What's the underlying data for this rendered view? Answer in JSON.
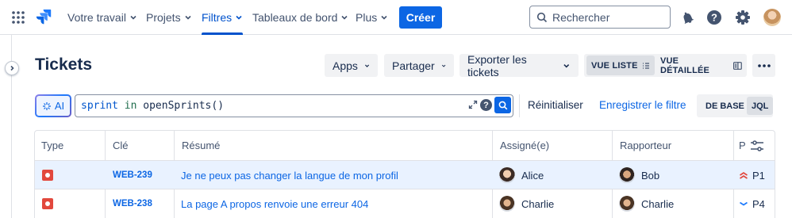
{
  "nav": {
    "items": [
      {
        "label": "Votre travail",
        "active": false
      },
      {
        "label": "Projets",
        "active": false
      },
      {
        "label": "Filtres",
        "active": true
      },
      {
        "label": "Tableaux de bord",
        "active": false
      },
      {
        "label": "Plus",
        "active": false
      }
    ],
    "create_label": "Créer",
    "search_placeholder": "Rechercher",
    "icons": [
      "app-switcher-icon",
      "jira-logo-icon",
      "notifications-icon",
      "help-icon",
      "settings-icon"
    ]
  },
  "page": {
    "title": "Tickets",
    "toolbar": {
      "apps": "Apps",
      "share": "Partager",
      "export": "Exporter les tickets",
      "list_view": "VUE LISTE",
      "detail_view": "VUE DÉTAILLÉE",
      "selected_view": "VUE LISTE"
    }
  },
  "jql": {
    "ai_label": "AI",
    "query_keyword1": "sprint",
    "query_op": " in ",
    "query_func": "openSprints()",
    "reset": "Réinitialiser",
    "save": "Enregistrer le filtre",
    "mode_basic": "DE BASE",
    "mode_jql": "JQL",
    "selected_mode": "JQL"
  },
  "table": {
    "headers": {
      "type": "Type",
      "key": "Clé",
      "summary": "Résumé",
      "assignee": "Assigné(e)",
      "reporter": "Rapporteur",
      "priority": "P"
    },
    "rows": [
      {
        "type": "bug",
        "key": "WEB-239",
        "summary": "Je ne peux pas changer la langue de mon profil",
        "assignee": "Alice",
        "reporter": "Bob",
        "priority": "P1",
        "priority_level": "highest",
        "selected": true
      },
      {
        "type": "bug",
        "key": "WEB-238",
        "summary": "La page A propos renvoie une erreur 404",
        "assignee": "Charlie",
        "reporter": "Charlie",
        "priority": "P4",
        "priority_level": "low",
        "selected": false
      }
    ]
  },
  "colors": {
    "brand": "#0C66E4",
    "bug": "#E2483D",
    "priority_high": "#E2483D",
    "priority_low": "#1D7AFC",
    "selected_row": "#E9F2FF"
  }
}
